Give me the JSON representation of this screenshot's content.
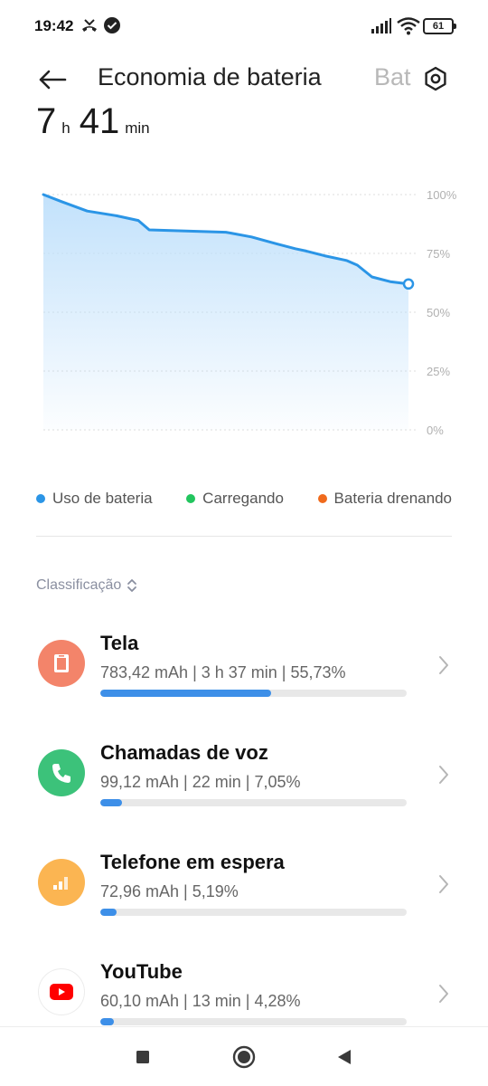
{
  "status_bar": {
    "time": "19:42",
    "battery_level": "61",
    "icons": [
      "missed-call-icon",
      "check-circle-icon",
      "signal-icon",
      "wifi-icon",
      "battery-icon"
    ]
  },
  "header": {
    "title": "Economia de bateria",
    "next_tab": "Bat",
    "back_icon": "arrow-left-icon",
    "settings_icon": "gear-icon"
  },
  "remaining": {
    "hours": "7",
    "hours_unit": "h",
    "minutes": "41",
    "minutes_unit": "min"
  },
  "chart_data": {
    "type": "area",
    "y_tick_labels": [
      "100%",
      "75%",
      "50%",
      "25%",
      "0%"
    ],
    "ylim": [
      0,
      100
    ],
    "grid": true,
    "x": [
      0,
      0.05,
      0.12,
      0.2,
      0.26,
      0.29,
      0.5,
      0.57,
      0.64,
      0.69,
      0.72,
      0.77,
      0.83,
      0.86,
      0.9,
      0.95,
      1.0
    ],
    "values": [
      100,
      97,
      93,
      91,
      89,
      85,
      84,
      82,
      79,
      77,
      76,
      74,
      72,
      70,
      65,
      63,
      62
    ],
    "line_color": "#2b95e6",
    "fill_color": "#bfe0fb"
  },
  "legend": [
    {
      "label": "Uso de bateria",
      "color": "#2b95e6"
    },
    {
      "label": "Carregando",
      "color": "#22c55e"
    },
    {
      "label": "Bateria drenando",
      "color": "#f06a1c"
    }
  ],
  "sort": {
    "label": "Classificação",
    "icon": "sort-updown-icon"
  },
  "apps": [
    {
      "name": "Tela",
      "stats": "783,42 mAh | 3 h 37 min  | 55,73%",
      "percent": 55.73,
      "icon": "screen-icon",
      "icon_color": "#f3846a"
    },
    {
      "name": "Chamadas de voz",
      "stats": "99,12 mAh | 22 min  | 7,05%",
      "percent": 7.05,
      "icon": "phone-icon",
      "icon_color": "#3cc27a"
    },
    {
      "name": "Telefone em espera",
      "stats": "72,96 mAh | 5,19%",
      "percent": 5.19,
      "icon": "signal-bars-icon",
      "icon_color": "#fbb552"
    },
    {
      "name": "YouTube",
      "stats": "60,10 mAh | 13 min  | 4,28%",
      "percent": 4.28,
      "icon": "youtube-icon",
      "icon_color": "#ffffff"
    }
  ],
  "nav": {
    "icons": [
      "recents-square-icon",
      "home-circle-icon",
      "back-triangle-icon"
    ]
  }
}
